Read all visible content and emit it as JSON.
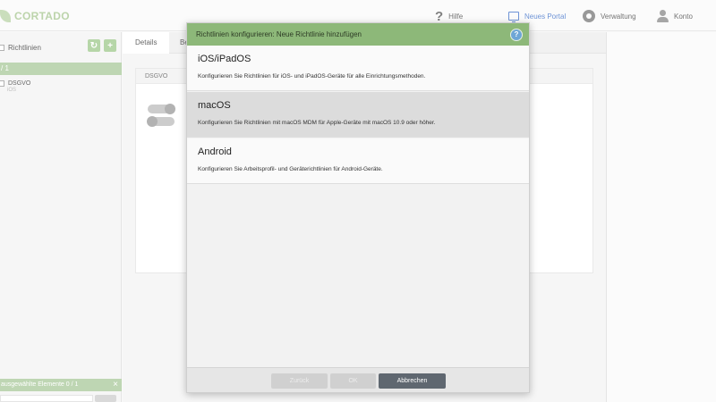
{
  "header": {
    "logo_text": "CORTADO",
    "help_label": "Hilfe",
    "portal_label": "Neues Portal",
    "admin_label": "Verwaltung",
    "account_label": "Konto"
  },
  "sidebar": {
    "title": "Richtlinien",
    "pager": "/ 1",
    "items": [
      {
        "title": "DSGVO",
        "subtitle": "iOS"
      }
    ],
    "footer": "ausgewählte Elemente  0  /  1"
  },
  "tabs": [
    {
      "label": "Details"
    },
    {
      "label": "Be"
    }
  ],
  "card": {
    "header": "DSGVO"
  },
  "modal": {
    "title": "Richtlinien konfigurieren: Neue Richtlinie hinzufügen",
    "help_glyph": "?",
    "options": [
      {
        "title": "iOS/iPadOS",
        "description": "Konfigurieren Sie Richtlinien für iOS- und iPadOS-Geräte für alle Einrichtungsmethoden."
      },
      {
        "title": "macOS",
        "description": "Konfigurieren Sie Richtlinien mit macOS MDM für Apple-Geräte mit macOS 10.9 oder höher."
      },
      {
        "title": "Android",
        "description": "Konfigurieren Sie Arbeitsprofil- und Geräterichtlinien für Android-Geräte."
      }
    ],
    "buttons": {
      "back": "Zurück",
      "ok": "OK",
      "cancel": "Abbrechen"
    }
  },
  "colors": {
    "accent_green": "#8db879",
    "portal_blue": "#3c6fc9",
    "cancel_button": "#5f6770"
  }
}
